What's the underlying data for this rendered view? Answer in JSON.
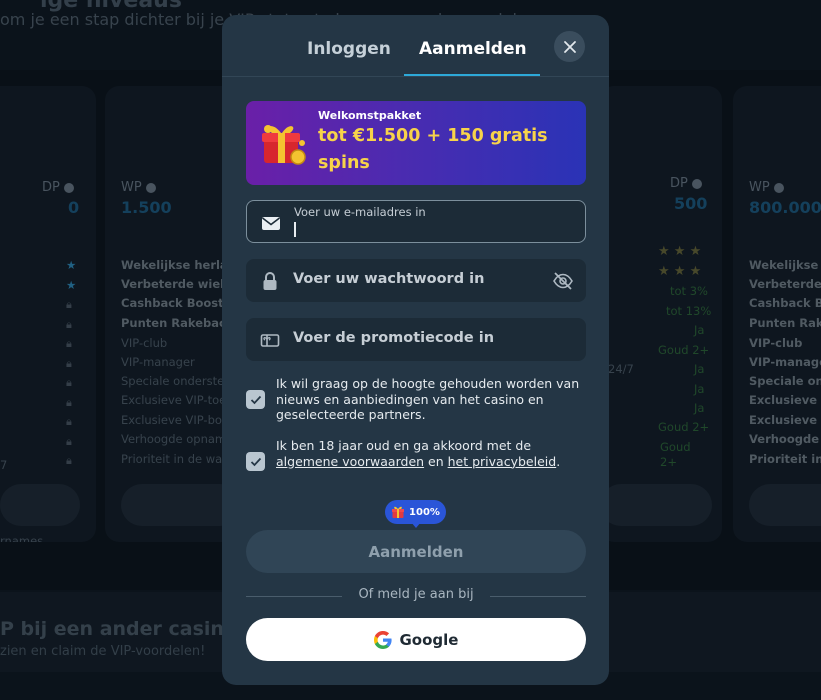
{
  "background": {
    "heading": "ige niveaus",
    "subheading": "om je een stap dichter bij je VIP-status te brengen en de voordelen",
    "cards": [
      {
        "level_label": "DP",
        "level_value": "0"
      },
      {
        "level_label": "WP",
        "level_value": "1.500",
        "benefits": [
          "Wekelijkse herladen",
          "Verbeterde wielen",
          "Cashback Boost",
          "Punten Rakeback",
          "VIP-club",
          "VIP-manager",
          "Speciale ondersteuning",
          "Exclusieve VIP-toernooien",
          "Exclusieve VIP-bonussen",
          "Verhoogde opnamelimieten",
          "Prioriteit in de wachtrij"
        ]
      },
      {
        "level_label": "DP",
        "level_value": "500",
        "values": [
          "tot 3%",
          "tot 13%",
          "Ja",
          "Goud 2+",
          "Ja",
          "Ja",
          "Ja",
          "Goud 2+",
          "Goud",
          "2+"
        ],
        "support_hours": "24/7"
      },
      {
        "level_label": "WP",
        "level_value": "800.000",
        "benefits": [
          "Wekelijkse herladen",
          "Verbeterde wielen",
          "Cashback Boost",
          "Punten Rakeback",
          "VIP-club",
          "VIP-manager",
          "Speciale ondersteuning",
          "Exclusieve VIP-toernooien",
          "Exclusieve VIP-bonussen",
          "Verhoogde opnamelimieten",
          "Prioriteit in de wachtrij"
        ]
      }
    ],
    "left_edge_texts": [
      "7",
      "rnames"
    ],
    "footer_title": "P bij een ander casino?",
    "footer_sub": "zien en claim de VIP-voordelen!"
  },
  "modal": {
    "tabs": [
      {
        "label": "Inloggen",
        "active": false
      },
      {
        "label": "Aanmelden",
        "active": true
      }
    ],
    "banner": {
      "small": "Welkomstpakket",
      "big": "tot €1.500 + 150 gratis spins"
    },
    "email": {
      "label": "Voer uw e-mailadres in",
      "icon": "envelope-icon"
    },
    "password": {
      "placeholder": "Voer uw wachtwoord in",
      "icon": "lock-icon",
      "toggle_icon": "eye-slash-icon"
    },
    "promo": {
      "placeholder": "Voer de promotiecode in",
      "icon": "gift-card-icon"
    },
    "checkbox_news": {
      "checked": true,
      "text": "Ik wil graag op de hoogte gehouden worden van nieuws en aanbiedingen van het casino en geselecteerde partners."
    },
    "checkbox_terms": {
      "checked": true,
      "text_before": "Ik ben 18 jaar oud en ga akkoord met de ",
      "link_terms": "algemene voorwaarden",
      "text_mid": " en ",
      "link_privacy": "het privacybeleid",
      "text_after": "."
    },
    "progress_badge": "100%",
    "submit_label": "Aanmelden",
    "divider_text": "Of meld je aan bij",
    "google_label": "Google",
    "colors": {
      "accent": "#2da9d9",
      "modal_bg": "#243645",
      "banner_text": "#f7d34a"
    }
  }
}
